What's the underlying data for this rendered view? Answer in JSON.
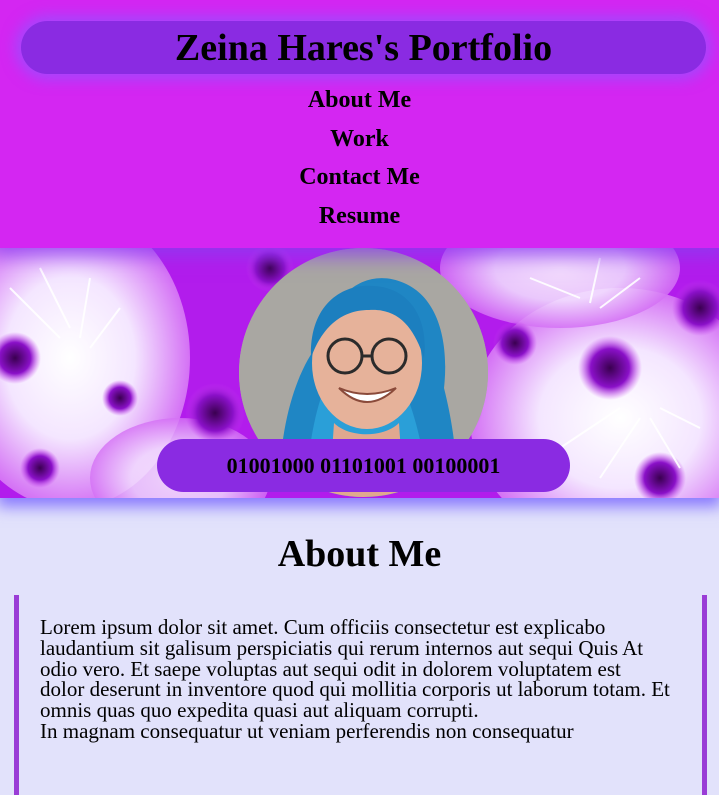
{
  "header": {
    "title": "Zeina Hares's Portfolio",
    "nav": [
      {
        "label": "About Me"
      },
      {
        "label": "Work"
      },
      {
        "label": "Contact Me"
      },
      {
        "label": "Resume"
      }
    ]
  },
  "banner": {
    "binary_text": "01001000 01101001 00100001"
  },
  "about": {
    "heading": "About Me",
    "paragraph_1": "Lorem ipsum dolor sit amet. Cum officiis consectetur est explicabo laudantium sit galisum perspiciatis qui rerum internos aut sequi Quis At odio vero. Et saepe voluptas aut sequi odit in dolorem voluptatem est dolor deserunt in inventore quod qui mollitia corporis ut laborum totam. Et omnis quas quo expedita quasi aut aliquam corrupti.",
    "paragraph_2": "In magnam consequatur ut veniam perferendis non consequatur"
  },
  "colors": {
    "header_bg": "#d426f2",
    "pill_bg": "#8a2be2",
    "page_bg": "#e2e2fb",
    "border_accent": "#9a3cd6"
  }
}
